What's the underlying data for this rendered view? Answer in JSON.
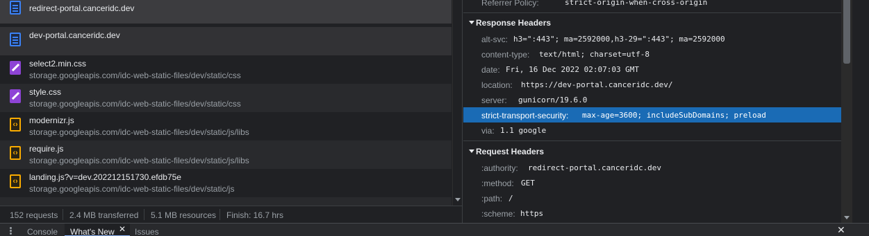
{
  "requests": [
    {
      "name": "redirect-portal.canceridc.dev",
      "path": "",
      "type": "doc"
    },
    {
      "name": "dev-portal.canceridc.dev",
      "path": "",
      "type": "doc"
    },
    {
      "name": "select2.min.css",
      "path": "storage.googleapis.com/idc-web-static-files/dev/static/css",
      "type": "css"
    },
    {
      "name": "style.css",
      "path": "storage.googleapis.com/idc-web-static-files/dev/static/css",
      "type": "css"
    },
    {
      "name": "modernizr.js",
      "path": "storage.googleapis.com/idc-web-static-files/dev/static/js/libs",
      "type": "js"
    },
    {
      "name": "require.js",
      "path": "storage.googleapis.com/idc-web-static-files/dev/static/js/libs",
      "type": "js"
    },
    {
      "name": "landing.js?v=dev.202212151730.efdb75e",
      "path": "storage.googleapis.com/idc-web-static-files/dev/static/js",
      "type": "js"
    }
  ],
  "statusbar": {
    "requests": "152 requests",
    "transferred": "2.4 MB transferred",
    "resources": "5.1 MB resources",
    "finish": "Finish: 16.7 hrs"
  },
  "partial_top": {
    "key": "Referrer Policy:",
    "value": "strict-origin-when-cross-origin"
  },
  "response_headers": {
    "title": "Response Headers",
    "items": [
      {
        "key": "alt-svc:",
        "value": "h3=\":443\"; ma=2592000,h3-29=\":443\"; ma=2592000"
      },
      {
        "key": "content-type:",
        "value": "text/html; charset=utf-8"
      },
      {
        "key": "date:",
        "value": "Fri, 16 Dec 2022 02:07:03 GMT"
      },
      {
        "key": "location:",
        "value": "https://dev-portal.canceridc.dev/"
      },
      {
        "key": "server:",
        "value": "gunicorn/19.6.0"
      },
      {
        "key": "strict-transport-security:",
        "value": "max-age=3600; includeSubDomains; preload"
      },
      {
        "key": "via:",
        "value": "1.1 google"
      }
    ]
  },
  "request_headers": {
    "title": "Request Headers",
    "items": [
      {
        "key": ":authority:",
        "value": "redirect-portal.canceridc.dev"
      },
      {
        "key": ":method:",
        "value": "GET"
      },
      {
        "key": ":path:",
        "value": "/"
      },
      {
        "key": ":scheme:",
        "value": "https"
      }
    ]
  },
  "drawer": {
    "tabs": [
      "Console",
      "What's New",
      "Issues"
    ],
    "active_tab": "What's New"
  },
  "colors": {
    "selection": "#1a6bb5",
    "doc_icon": "#3b82f6",
    "css_icon": "#8e44d6",
    "js_icon": "#f9ab00"
  }
}
